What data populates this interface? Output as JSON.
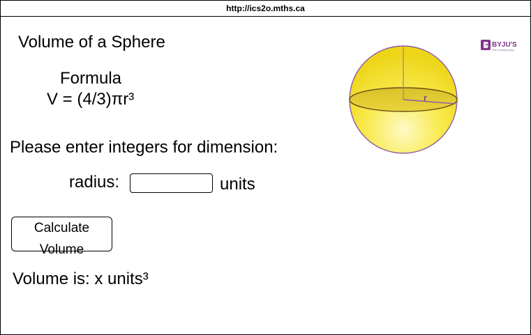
{
  "browser": {
    "url": "http://ics2o.mths.ca"
  },
  "page": {
    "title": "Volume of a Sphere",
    "formula_label": "Formula",
    "formula": "V = (4/3)πr³",
    "prompt": "Please enter integers for dimension:",
    "radius_label": "radius:",
    "radius_value": "",
    "units_label": "units",
    "calculate_button": "Calculate Volume",
    "result_text": "Volume is: x units³"
  },
  "image": {
    "radius_marker": "r",
    "logo_text": "BYJU'S",
    "logo_tagline": "The Learning App",
    "colors": {
      "sphere": "#f7e23a",
      "sphere_outline": "#8a5ba5",
      "logo": "#813588"
    }
  }
}
